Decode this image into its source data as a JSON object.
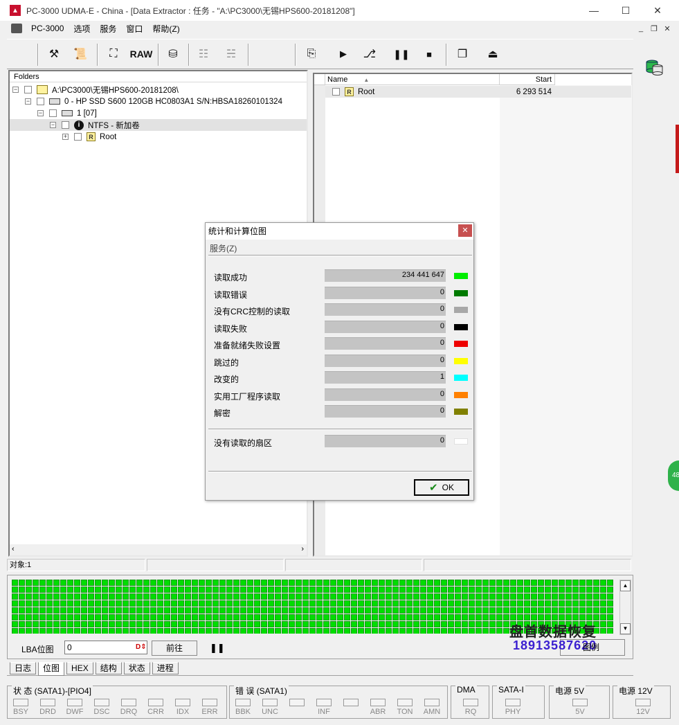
{
  "window": {
    "title": "PC-3000 UDMA-E - China - [Data Extractor : 任务 - \"A:\\PC3000\\无锡HPS600-20181208\"]",
    "app_icon": "pc3000-logo-icon"
  },
  "menu": {
    "items": [
      "PC-3000",
      "选项",
      "服务",
      "窗口",
      "帮助(Z)"
    ]
  },
  "toolbar": {
    "raw_label": "RAW"
  },
  "folders": {
    "header": "Folders",
    "tree": [
      {
        "label": "A:\\PC3000\\无锡HPS600-20181208\\",
        "expander": "−"
      },
      {
        "label": "0 - HP SSD S600 120GB HC0803A1 S/N:HBSA18260101324",
        "expander": "−"
      },
      {
        "label": "1 [07]",
        "expander": "−"
      },
      {
        "label": "NTFS - 新加卷",
        "expander": "−"
      },
      {
        "label": "Root",
        "expander": "+"
      }
    ]
  },
  "file_list": {
    "col_name": "Name",
    "col_start": "Start",
    "rows": [
      {
        "name": "Root",
        "start": "6 293 514"
      }
    ]
  },
  "status": {
    "objects": "对象:1"
  },
  "bitmap": {
    "lba_label": "LBA位图",
    "lba_value": "0",
    "go_label": "前往",
    "block_color": "#00dd00"
  },
  "watermark": {
    "title": "盘首数据恢复",
    "phone": "18913587620",
    "button_label": "图例"
  },
  "tabs": [
    "日志",
    "位图",
    "HEX",
    "结构",
    "状态",
    "进程"
  ],
  "hw_status": {
    "state_title": "状 态 (SATA1)-[PIO4]",
    "state_leds": [
      "BSY",
      "DRD",
      "DWF",
      "DSC",
      "DRQ",
      "CRR",
      "IDX",
      "ERR"
    ],
    "error_title": "错 误 (SATA1)",
    "error_leds": [
      "BBK",
      "UNC",
      "",
      "INF",
      "",
      "ABR",
      "TON",
      "AMN"
    ],
    "dma_title": "DMA",
    "dma_leds": [
      "RQ"
    ],
    "sata_title": "SATA-I",
    "sata_leds": [
      "PHY"
    ],
    "p5_title": "电源 5V",
    "p5_leds": [
      "5V"
    ],
    "p12_title": "电源 12V",
    "p12_leds": [
      "12V"
    ]
  },
  "dialog": {
    "title": "统计和计算位图",
    "menu": "服务(Z)",
    "stats": [
      {
        "label": "读取成功",
        "value": "234 441 647",
        "color": "#00ee00"
      },
      {
        "label": "读取错误",
        "value": "0",
        "color": "#007a00"
      },
      {
        "label": "没有CRC控制的读取",
        "value": "0",
        "color": "#a8a8a8"
      },
      {
        "label": "读取失败",
        "value": "0",
        "color": "#000000"
      },
      {
        "label": "准备就绪失败设置",
        "value": "0",
        "color": "#ee0000"
      },
      {
        "label": "跳过的",
        "value": "0",
        "color": "#ffff00"
      },
      {
        "label": "改变的",
        "value": "1",
        "color": "#00ffff"
      },
      {
        "label": "实用工厂程序读取",
        "value": "0",
        "color": "#ff8000"
      },
      {
        "label": "解密",
        "value": "0",
        "color": "#808000"
      }
    ],
    "unread": {
      "label": "没有读取的扇区",
      "value": "0",
      "color": "#ffffff"
    },
    "ok_label": "OK"
  }
}
